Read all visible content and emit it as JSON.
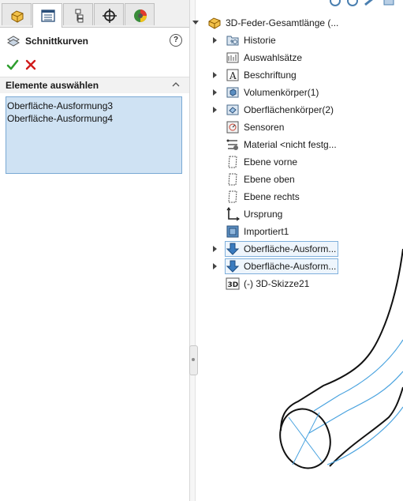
{
  "tabs": [
    {
      "name": "feature-manager-tab",
      "icon": "feature-tree-icon"
    },
    {
      "name": "property-manager-tab",
      "icon": "property-list-icon"
    },
    {
      "name": "configuration-manager-tab",
      "icon": "configuration-icon"
    },
    {
      "name": "dimxpert-tab",
      "icon": "crosshair-icon"
    },
    {
      "name": "display-manager-tab",
      "icon": "appearance-ball-icon"
    }
  ],
  "property_manager": {
    "title": "Schnittkurven",
    "help_symbol": "?",
    "section_label": "Elemente auswählen",
    "selected_items": [
      "Oberfläche-Ausformung3",
      "Oberfläche-Ausformung4"
    ]
  },
  "tree": {
    "root": "3D-Feder-Gesamtlänge  (...",
    "items": [
      {
        "label": "Historie",
        "icon": "history-folder-icon",
        "expand": true
      },
      {
        "label": "Auswahlsätze",
        "icon": "selection-sets-icon",
        "expand": false
      },
      {
        "label": "Beschriftung",
        "icon": "annotation-icon",
        "expand": true
      },
      {
        "label": "Volumenkörper(1)",
        "icon": "solid-bodies-icon",
        "expand": true
      },
      {
        "label": "Oberflächenkörper(2)",
        "icon": "surface-bodies-icon",
        "expand": true
      },
      {
        "label": "Sensoren",
        "icon": "sensor-icon",
        "expand": false
      },
      {
        "label": "Material <nicht festg...",
        "icon": "material-icon",
        "expand": false
      },
      {
        "label": "Ebene vorne",
        "icon": "plane-icon",
        "expand": false
      },
      {
        "label": "Ebene oben",
        "icon": "plane-icon",
        "expand": false
      },
      {
        "label": "Ebene rechts",
        "icon": "plane-icon",
        "expand": false
      },
      {
        "label": "Ursprung",
        "icon": "origin-icon",
        "expand": false
      },
      {
        "label": "Importiert1",
        "icon": "imported-body-icon",
        "expand": false
      },
      {
        "label": "Oberfläche-Ausform...",
        "icon": "loft-surface-icon",
        "expand": true,
        "selected": true
      },
      {
        "label": "Oberfläche-Ausform...",
        "icon": "loft-surface-icon",
        "expand": true,
        "selected": true
      },
      {
        "label": "(-) 3D-Skizze21",
        "icon": "sketch-3d-icon",
        "expand": false,
        "badge": "3D"
      }
    ]
  },
  "colors": {
    "accent": "#7aa9d4",
    "selection_fill": "#cfe2f3",
    "ok_green": "#2e9e2e",
    "cancel_red": "#d11b1b",
    "edge": "#111111",
    "tangent_edge": "#4aa3df"
  }
}
